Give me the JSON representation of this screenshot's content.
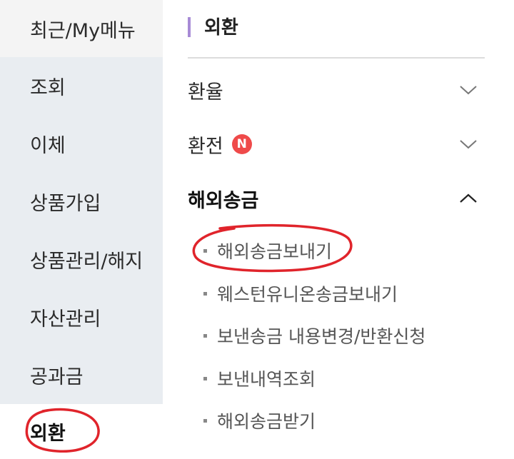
{
  "sidebar": {
    "items": [
      {
        "label": "최근/My메뉴"
      },
      {
        "label": "조회"
      },
      {
        "label": "이체"
      },
      {
        "label": "상품가입"
      },
      {
        "label": "상품관리/해지"
      },
      {
        "label": "자산관리"
      },
      {
        "label": "공과금"
      },
      {
        "label": "외환"
      }
    ],
    "active": "외환"
  },
  "main": {
    "title": "외환",
    "accordion": [
      {
        "label": "환율",
        "expanded": false,
        "icon": "chevron-down-icon"
      },
      {
        "label": "환전",
        "badge": "N",
        "expanded": false,
        "icon": "chevron-down-icon"
      },
      {
        "label": "해외송금",
        "expanded": true,
        "icon": "chevron-up-icon"
      }
    ],
    "sub_items": [
      {
        "label": "해외송금보내기"
      },
      {
        "label": "웨스턴유니온송금보내기"
      },
      {
        "label": "보낸송금 내용변경/반환신청"
      },
      {
        "label": "보낸내역조회"
      },
      {
        "label": "해외송금받기"
      }
    ]
  },
  "colors": {
    "sidebar_bg": "#e9edf1",
    "accent_bar": "#a78bd6",
    "badge": "#ef4a4a",
    "annotation": "#e0242b"
  }
}
